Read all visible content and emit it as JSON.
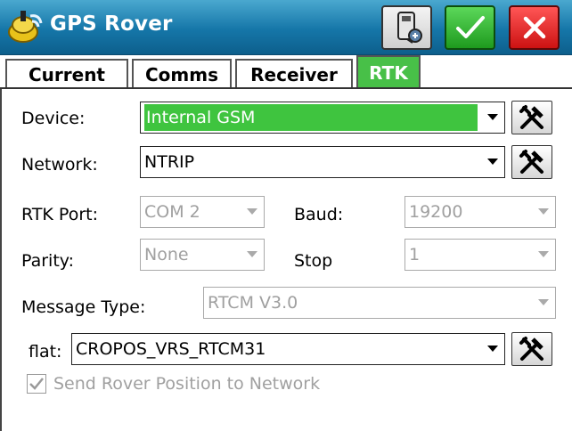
{
  "window": {
    "title": "GPS Rover"
  },
  "tabs": [
    {
      "label": "Current",
      "active": false
    },
    {
      "label": "Comms",
      "active": false
    },
    {
      "label": "Receiver",
      "active": false
    },
    {
      "label": "RTK",
      "active": true
    }
  ],
  "form": {
    "device": {
      "label": "Device:",
      "value": "Internal GSM"
    },
    "network": {
      "label": "Network:",
      "value": "NTRIP"
    },
    "rtk_port": {
      "label": "RTK Port:",
      "value": "COM 2"
    },
    "baud": {
      "label": "Baud:",
      "value": "19200"
    },
    "parity": {
      "label": "Parity:",
      "value": "None"
    },
    "stop": {
      "label": "Stop",
      "value": "1"
    },
    "message_type": {
      "label": "Message Type:",
      "value": "RTCM V3.0"
    },
    "flat": {
      "label": "flat:",
      "value": "CROPOS_VRS_RTCM31"
    },
    "send_position": {
      "label": "Send Rover Position to Network",
      "checked": true
    }
  },
  "colors": {
    "title_bar": "#1576a8",
    "accent_green": "#3fc43f",
    "cancel_red": "#cc1212",
    "disabled_text": "#a0a0a0"
  }
}
